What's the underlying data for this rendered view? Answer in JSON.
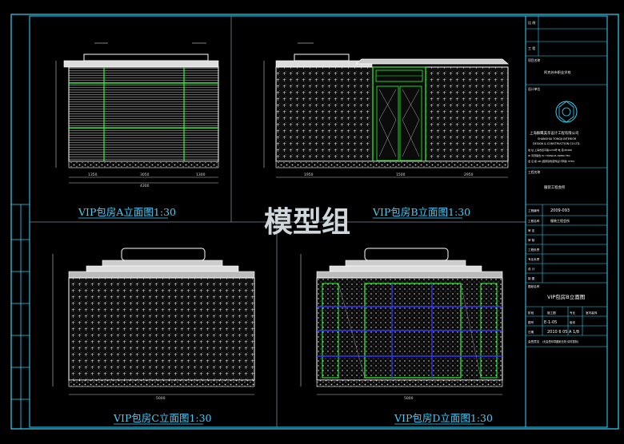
{
  "watermark": "模型组",
  "drawing": {
    "titles": {
      "a": "VIP包房A立面图1:30",
      "b": "VIP包房B立面图1:30",
      "c": "VIP包房C立面图1:30",
      "d": "VIP包房D立面图1:30"
    },
    "dims": {
      "a_bottom": [
        "1350",
        "3050",
        "1300"
      ],
      "a_total": "4300",
      "b_bottom": [
        "1950",
        "1500",
        "2950"
      ],
      "b_total": "6800",
      "c_total": "5000",
      "d_total": "5000"
    }
  },
  "title_block": {
    "r1_a": "比 例",
    "r1_b": "",
    "r1_c": "工 程",
    "project_label": "项目名称",
    "project_name": "阿克苏市职业学校",
    "design_label": "设计单位",
    "company_cn": "上海群鹰美华设计工程有限公司",
    "company_en1": "SHANGHAI TONGJI INTERIOR",
    "company_en2": "DESIGN & CONSTRUCTION CO.LTD.",
    "contact1": "地 址:上海市四平路1239号   电 话:65980",
    "contact2": "ID 同济联合 IS: TRONGIS 39880 F80",
    "contact3": "发 证 级 AB (国家建筑装饰设计甲级)    8784",
    "client_label": "工程名称",
    "client_value": "服装工程会所",
    "num_label": "工程编号",
    "num_value": "2009-093",
    "name_label": "工程名称",
    "name_value": "服装工程会所",
    "roles": [
      "审 定",
      "审 核",
      "工程负责",
      "专业负责",
      "设 计",
      "制 图"
    ],
    "sheet_label": "图纸名称",
    "sheet_name": "VIP包房B立面图",
    "stage_label": "阶段",
    "stage_value": "施工图",
    "major_label": "专业",
    "major_value": "室内装饰",
    "no_label": "图号",
    "no_value": "E-1-05",
    "ver_label": "版本",
    "ver_value": "",
    "date_label": "日期",
    "date_value": "2010 6 05 A  1/8",
    "note_label": "会签意见",
    "note_value": "(无会签印章图纸无效·请勿复制)"
  }
}
